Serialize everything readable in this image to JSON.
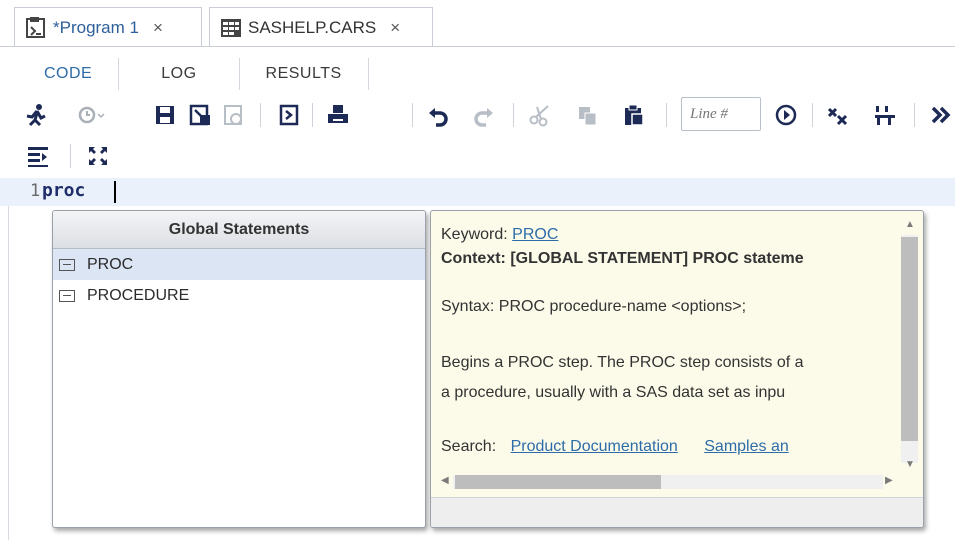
{
  "tabs": [
    {
      "label": "*Program 1",
      "close": "×",
      "active": true
    },
    {
      "label": "SASHELP.CARS",
      "close": "×",
      "active": false
    }
  ],
  "sub_tabs": [
    "CODE",
    "LOG",
    "RESULTS"
  ],
  "toolbar": {
    "line_placeholder": "Line #",
    "icons": [
      "run-icon",
      "history-icon",
      "save-icon",
      "save-as-icon",
      "save-local-icon",
      "export-icon",
      "print-icon",
      "undo-icon",
      "redo-icon",
      "cut-icon",
      "copy-icon",
      "paste-icon",
      "goto-line-icon",
      "clear-icon",
      "format-code-icon",
      "more-icon",
      "list-icon",
      "maximize-icon"
    ]
  },
  "editor": {
    "line_number": "1",
    "code": "proc"
  },
  "autocomplete": {
    "header": "Global Statements",
    "items": [
      "PROC",
      "PROCEDURE"
    ],
    "selected": "PROC"
  },
  "info": {
    "keyword_label": "Keyword:",
    "keyword": "PROC",
    "context": "Context: [GLOBAL STATEMENT] PROC stateme",
    "syntax": "Syntax: PROC procedure-name <options>;",
    "desc1": "Begins a PROC step. The PROC step consists of a",
    "desc2": "a procedure, usually with a SAS data set as inpu",
    "search_label": "Search:",
    "search_link1": "Product Documentation",
    "search_link2": "Samples an"
  },
  "colors": {
    "accent": "#2d6ca8",
    "selected_row": "#dbe5f4",
    "info_bg": "#fcfbea",
    "current_line": "#eaf1fb"
  }
}
